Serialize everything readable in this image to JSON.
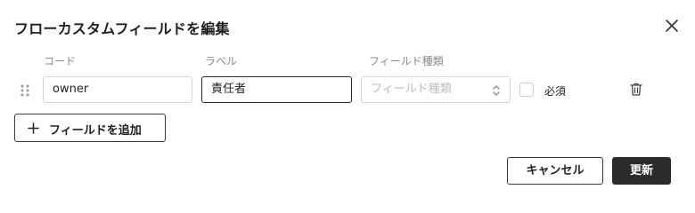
{
  "dialog": {
    "title": "フローカスタムフィールドを編集",
    "close_icon": "close-icon"
  },
  "columns": {
    "code": "コード",
    "label": "ラベル",
    "type": "フィールド種類"
  },
  "row": {
    "code_value": "owner",
    "label_value": "責任者",
    "type_placeholder": "フィールド種類",
    "required_label": "必須",
    "required_checked": false,
    "drag_icon": "drag-handle-icon",
    "delete_icon": "trash-icon",
    "select_icon": "chevron-up-down-icon"
  },
  "actions": {
    "add_field": "フィールドを追加",
    "add_icon": "plus-icon",
    "cancel": "キャンセル",
    "update": "更新"
  },
  "colors": {
    "primary_button": "#2b2b2b",
    "border": "#d6d6d6",
    "muted_text": "#8a8a8a"
  }
}
